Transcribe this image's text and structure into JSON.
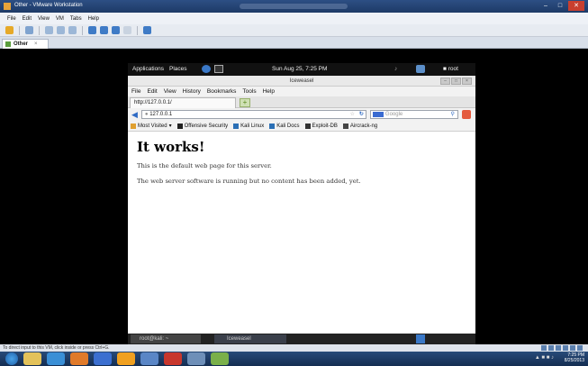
{
  "host": {
    "window_title": "Other - VMware Workstation",
    "menu": [
      "File",
      "Edit",
      "View",
      "VM",
      "Tabs",
      "Help"
    ],
    "tab_label": "Other",
    "status_text": "To direct input to this VM, click inside or press Ctrl+G.",
    "clock_time": "7:25 PM",
    "clock_date": "8/25/2013"
  },
  "guest_panel": {
    "applications": "Applications",
    "places": "Places",
    "clock": "Sun Aug 25,  7:25 PM",
    "user": "root"
  },
  "browser": {
    "window_title": "Iceweasel",
    "menu": [
      "File",
      "Edit",
      "View",
      "History",
      "Bookmarks",
      "Tools",
      "Help"
    ],
    "tab_title": "http://127.0.0.1/",
    "new_tab": "+",
    "url": "127.0.0.1",
    "search_placeholder": "Google",
    "bookmarks": [
      "Most Visited",
      "Offensive Security",
      "Kali Linux",
      "Kali Docs",
      "Exploit-DB",
      "Aircrack-ng"
    ],
    "page": {
      "heading": "It works!",
      "p1": "This is the default web page for this server.",
      "p2": "The web server software is running but no content has been added, yet."
    }
  },
  "guest_taskbar": {
    "task1": "root@kali: ~",
    "task2": "Iceweasel"
  },
  "colors": {
    "host_titlebar": "#2d4f84",
    "taskbar": "#1d3a66",
    "guest_bg": "#000000",
    "accent": "#2f6bc4"
  }
}
